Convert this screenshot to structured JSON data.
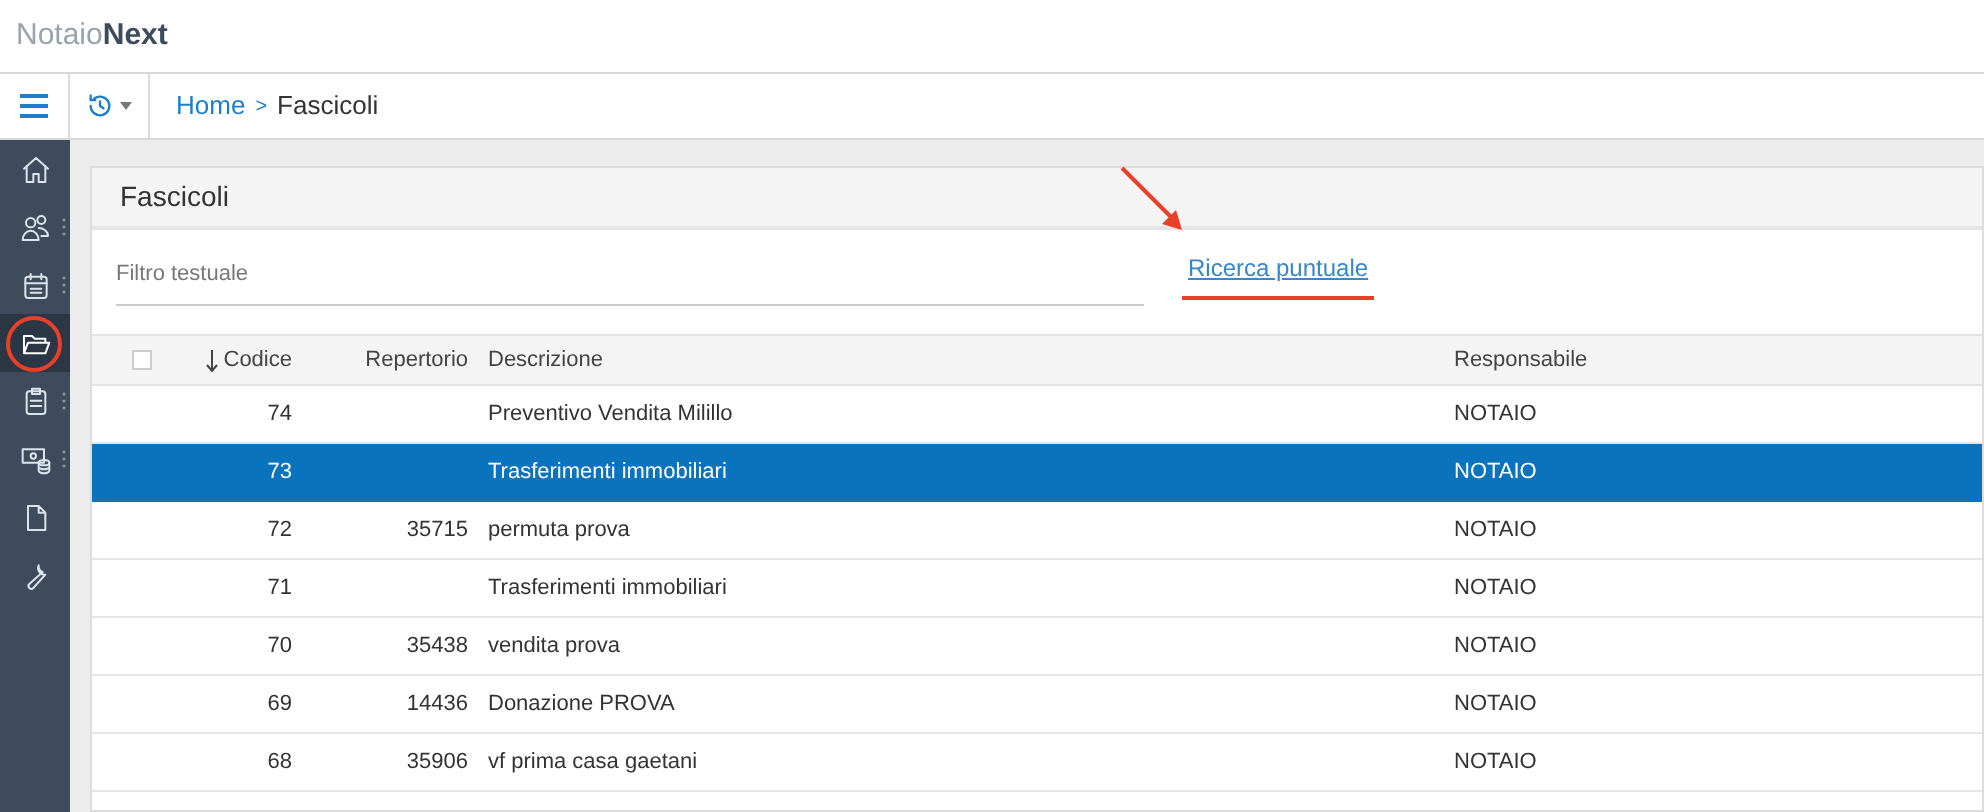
{
  "app": {
    "logo_light": "Notaio",
    "logo_bold": "Next"
  },
  "breadcrumb": {
    "home": "Home",
    "separator": ">",
    "current": "Fascicoli"
  },
  "sidebar": {
    "items": [
      {
        "kind": "home",
        "selected": false,
        "submenu": false
      },
      {
        "kind": "users",
        "selected": false,
        "submenu": true
      },
      {
        "kind": "calendar",
        "selected": false,
        "submenu": true
      },
      {
        "kind": "folder",
        "selected": true,
        "submenu": false
      },
      {
        "kind": "clipboard",
        "selected": false,
        "submenu": true
      },
      {
        "kind": "money",
        "selected": false,
        "submenu": true
      },
      {
        "kind": "document",
        "selected": false,
        "submenu": false
      },
      {
        "kind": "wrench",
        "selected": false,
        "submenu": false
      }
    ]
  },
  "panel": {
    "title": "Fascicoli",
    "filter_placeholder": "Filtro testuale",
    "link": "Ricerca puntuale"
  },
  "table": {
    "select_all": {
      "checked": false
    },
    "columns": [
      {
        "label": "Codice",
        "sorted": true,
        "descending": true
      },
      {
        "label": "Repertorio"
      },
      {
        "label": "Descrizione"
      },
      {
        "label": "Responsabile"
      }
    ],
    "rows": [
      {
        "codice": "74",
        "repertorio": "",
        "descrizione": "Preventivo Vendita Milillo",
        "responsabile": "NOTAIO",
        "selected": false
      },
      {
        "codice": "73",
        "repertorio": "",
        "descrizione": "Trasferimenti immobiliari",
        "responsabile": "NOTAIO",
        "selected": true
      },
      {
        "codice": "72",
        "repertorio": "35715",
        "descrizione": "permuta prova",
        "responsabile": "NOTAIO",
        "selected": false
      },
      {
        "codice": "71",
        "repertorio": "",
        "descrizione": "Trasferimenti immobiliari",
        "responsabile": "NOTAIO",
        "selected": false
      },
      {
        "codice": "70",
        "repertorio": "35438",
        "descrizione": "vendita prova",
        "responsabile": "NOTAIO",
        "selected": false
      },
      {
        "codice": "69",
        "repertorio": "14436",
        "descrizione": "Donazione PROVA",
        "responsabile": "NOTAIO",
        "selected": false
      },
      {
        "codice": "68",
        "repertorio": "35906",
        "descrizione": "vf prima casa gaetani",
        "responsabile": "NOTAIO",
        "selected": false
      }
    ]
  }
}
